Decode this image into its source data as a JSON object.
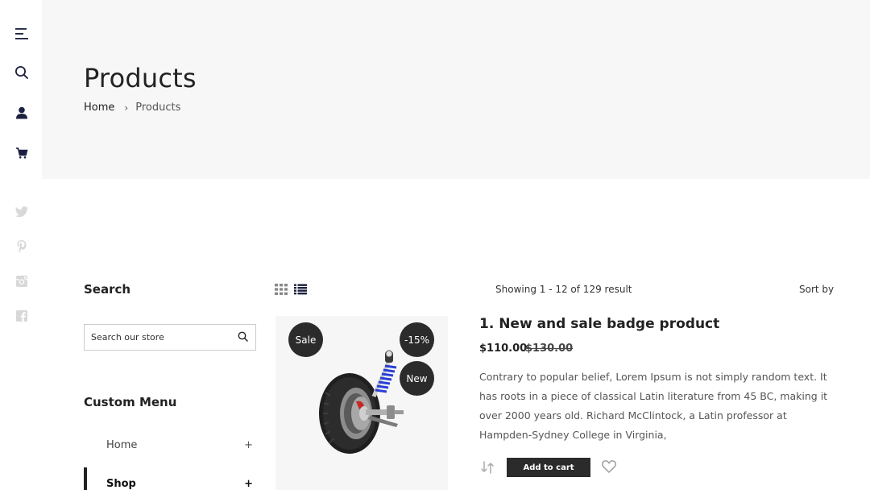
{
  "rail": {
    "icons": [
      "menu-icon",
      "search-icon",
      "user-icon",
      "cart-icon",
      "twitter-icon",
      "pinterest-icon",
      "instagram-icon",
      "facebook-icon"
    ]
  },
  "hero": {
    "title": "Products",
    "breadcrumb": {
      "home": "Home",
      "separator": "›",
      "current": "Products"
    }
  },
  "sidebar": {
    "search_heading": "Search",
    "search_placeholder": "Search our store",
    "menu_heading": "Custom Menu",
    "menu_items": [
      {
        "label": "Home",
        "toggle": "+"
      },
      {
        "label": "Shop",
        "toggle": "+"
      }
    ]
  },
  "toolbar": {
    "showing": "Showing 1 - 12 of 129 result",
    "sort_by": "Sort by"
  },
  "product": {
    "badges": {
      "sale": "Sale",
      "discount": "-15%",
      "new": "New"
    },
    "title": "1. New and sale badge product",
    "price": "$110.00",
    "old_price": "$130.00",
    "description": "Contrary to popular belief, Lorem Ipsum is not simply random text. It has roots in a piece of classical Latin literature from 45 BC, making it over 2000 years old. Richard McClintock, a Latin professor at Hampden-Sydney College in Virginia,",
    "add_to_cart": "Add to cart"
  },
  "colors": {
    "hero_bg": "#f7f7f7",
    "dark": "#2b2b2b",
    "rail_accent": "#1c2140",
    "social_muted": "#d8d8d8",
    "shock_blue": "#2a3fd6",
    "brake_red": "#c62828"
  }
}
